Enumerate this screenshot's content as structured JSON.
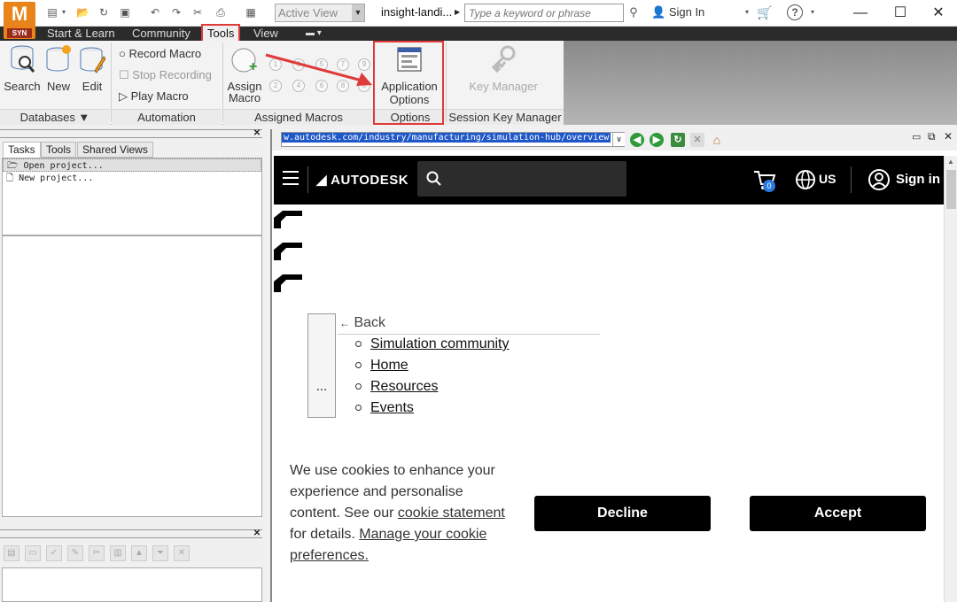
{
  "app": {
    "logo_letter": "M",
    "logo_badge": "SYN",
    "view_select": "Active View",
    "doc_title": "insight-landi...",
    "search_placeholder": "Type a keyword or phrase",
    "sign_in": "Sign In"
  },
  "tabs": [
    "Start & Learn",
    "Community",
    "Tools",
    "View"
  ],
  "ribbon": {
    "databases": {
      "search": "Search",
      "new": "New",
      "edit": "Edit",
      "label": "Databases ▼"
    },
    "automation": {
      "record": "Record Macro",
      "stop": "Stop Recording",
      "play": "Play Macro",
      "label": "Automation"
    },
    "assigned": {
      "assign_line1": "Assign",
      "assign_line2": "Macro",
      "label": "Assigned Macros",
      "slots": [
        "1",
        "3",
        "5",
        "7",
        "9",
        "2",
        "4",
        "6",
        "8",
        "0"
      ]
    },
    "options": {
      "line1": "Application",
      "line2": "Options",
      "label": "Options"
    },
    "session": {
      "key_manager": "Key Manager",
      "label": "Session Key Manager"
    }
  },
  "left_panel": {
    "tabs": [
      "Tasks",
      "Tools",
      "Shared Views"
    ],
    "tasks": [
      "Open project...",
      "New project..."
    ]
  },
  "browser": {
    "url": "w.autodesk.com/industry/manufacturing/simulation-hub/overview"
  },
  "site": {
    "brand": "AUTODESK",
    "cart_count": "0",
    "region": "US",
    "sign_in": "Sign in",
    "dots": "...",
    "back": "Back",
    "menu": [
      "Simulation community",
      "Home",
      "Resources",
      "Events"
    ],
    "cookie": {
      "text1": "We use cookies to enhance your experience and personalise content. See our ",
      "link1": "cookie statement",
      "text2": " for details. ",
      "link2": "Manage your cookie preferences."
    },
    "decline": "Decline",
    "accept": "Accept"
  },
  "colors": {
    "accent": "#e03a3a",
    "logo": "#e8841a",
    "badge": "#2a7ae2"
  }
}
